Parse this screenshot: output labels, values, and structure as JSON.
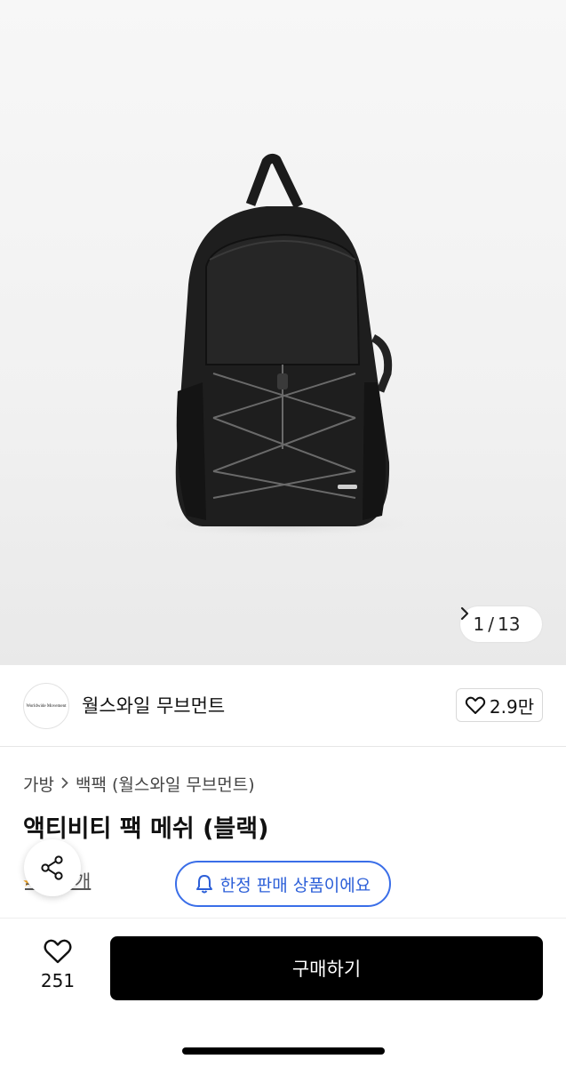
{
  "gallery": {
    "current": "1",
    "separator": "/",
    "total": "13"
  },
  "brand": {
    "logo_text": "Worldwide Movement",
    "name": "월스와일 무브먼트",
    "likes": "2.9만"
  },
  "breadcrumb": {
    "category": "가방",
    "subcategory": "백팩 (월스와일 무브먼트)"
  },
  "product": {
    "title": "액티비티 팩 메쉬 (블랙)",
    "review_link": "후기 3개",
    "limited_badge": "한정 판매 상품이에요"
  },
  "bottom_bar": {
    "wish_count": "251",
    "buy_label": "구매하기"
  },
  "colors": {
    "accent_blue": "#3a6ee8",
    "buy_button": "#000000",
    "star": "#f5a623"
  },
  "icons": [
    "heart-icon",
    "chevron-right-icon",
    "share-icon",
    "bell-icon",
    "star-icon"
  ]
}
